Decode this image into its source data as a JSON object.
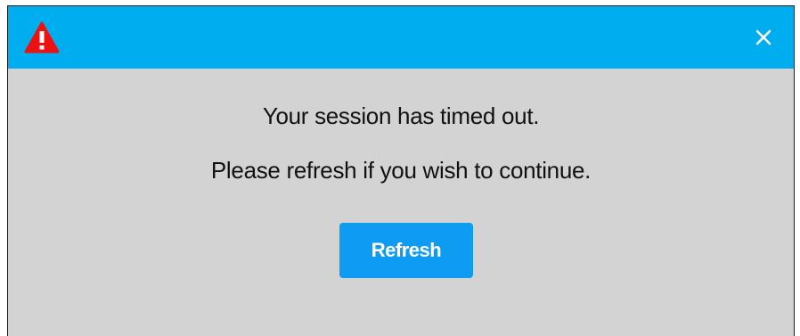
{
  "dialog": {
    "header": {
      "warning_icon": "warning-triangle-icon",
      "close_icon": "close-icon",
      "colors": {
        "header_background": "#00adef",
        "warning_icon": "#ee1111",
        "close_icon": "#ffffff"
      }
    },
    "message_line_1": "Your session has timed out.",
    "message_line_2": "Please refresh if you wish to continue.",
    "refresh_label": "Refresh",
    "colors": {
      "body_background": "#d3d3d3",
      "button_background": "#0e9cf3",
      "button_text": "#ffffff"
    }
  }
}
